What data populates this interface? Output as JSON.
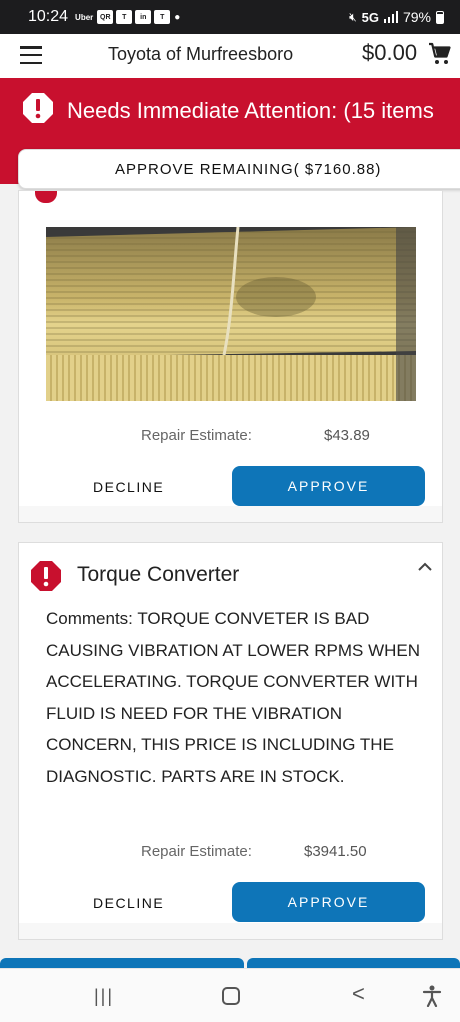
{
  "status_bar": {
    "time": "10:24",
    "notification_labels": [
      "Uber",
      "QR",
      "T",
      "in",
      "T"
    ],
    "network": "5G",
    "battery": "79%"
  },
  "app_bar": {
    "title": "Toyota of Murfreesboro",
    "cart_total": "$0.00"
  },
  "alert": {
    "text": "Needs Immediate Attention: (15 items",
    "approve_remaining": "APPROVE REMAINING( $7160.88)"
  },
  "cards": [
    {
      "repair_label": "Repair Estimate:",
      "repair_value": "$43.89",
      "decline": "DECLINE",
      "approve": "APPROVE"
    },
    {
      "title": "Torque Converter",
      "comments": "Comments: TORQUE CONVETER IS BAD CAUSING VIBRATION AT LOWER RPMS WHEN ACCELERATING. TORQUE CONVERTER WITH FLUID IS NEED FOR THE VIBRATION CONCERN, THIS PRICE IS INCLUDING THE DIAGNOSTIC. PARTS ARE IN STOCK.",
      "repair_label": "Repair Estimate:",
      "repair_value": "$3941.50",
      "decline": "DECLINE",
      "approve": "APPROVE"
    }
  ],
  "colors": {
    "alert_red": "#c8102e",
    "approve_blue": "#0e75b8"
  }
}
